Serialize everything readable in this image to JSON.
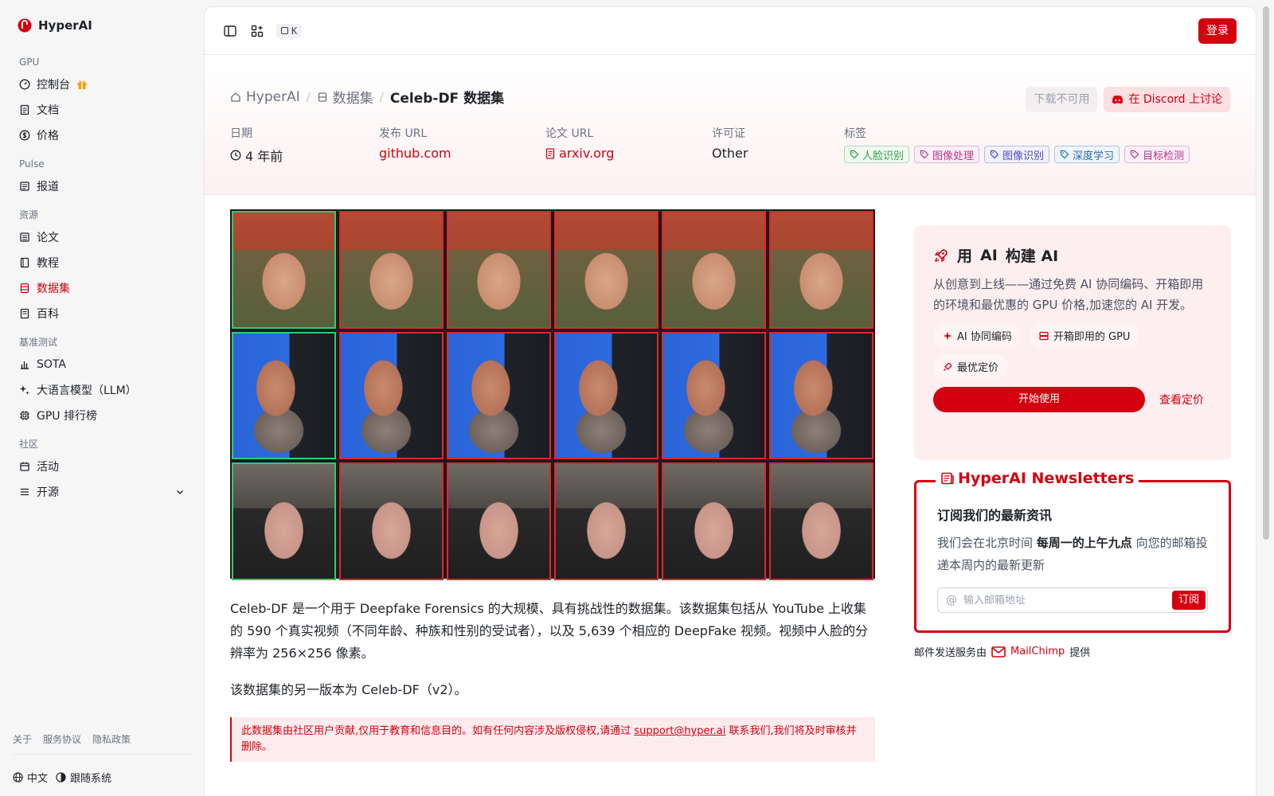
{
  "brand": {
    "name": "HyperAI"
  },
  "sidebar": {
    "groups": [
      {
        "title": "GPU",
        "items": [
          {
            "label": "控制台",
            "icon": "dashboard-icon",
            "gift": true
          },
          {
            "label": "文档",
            "icon": "doc-icon"
          },
          {
            "label": "价格",
            "icon": "price-icon"
          }
        ]
      },
      {
        "title": "Pulse",
        "items": [
          {
            "label": "报道",
            "icon": "news-icon"
          }
        ]
      },
      {
        "title": "资源",
        "items": [
          {
            "label": "论文",
            "icon": "paper-icon"
          },
          {
            "label": "教程",
            "icon": "tutorial-icon"
          },
          {
            "label": "数据集",
            "icon": "database-icon",
            "active": true
          },
          {
            "label": "百科",
            "icon": "wiki-icon"
          }
        ]
      },
      {
        "title": "基准测试",
        "items": [
          {
            "label": "SOTA",
            "icon": "chart-icon"
          },
          {
            "label": "大语言模型（LLM）",
            "icon": "sparkle-icon"
          },
          {
            "label": "GPU 排行榜",
            "icon": "cpu-icon"
          }
        ]
      },
      {
        "title": "社区",
        "items": [
          {
            "label": "活动",
            "icon": "calendar-icon"
          },
          {
            "label": "开源",
            "icon": "menu-icon",
            "expand": true
          }
        ]
      }
    ],
    "footer_links": [
      "关于",
      "服务协议",
      "隐私政策"
    ],
    "language": "中文",
    "theme": "跟随系统"
  },
  "topbar": {
    "shortcut": "K",
    "login": "登录"
  },
  "breadcrumb": {
    "home": "HyperAI",
    "section": "数据集",
    "current": "Celeb-DF 数据集"
  },
  "hero_actions": {
    "download": "下载不可用",
    "discord": "在 Discord 上讨论"
  },
  "meta": {
    "date_label": "日期",
    "date": "4 年前",
    "release_label": "发布 URL",
    "release": "github.com",
    "paper_label": "论文 URL",
    "paper": "arxiv.org",
    "license_label": "许可证",
    "license": "Other",
    "tags_label": "标签",
    "tags": [
      {
        "label": "人脸识别",
        "color": "#2f9e44",
        "bg": "#f0faf2"
      },
      {
        "label": "图像处理",
        "color": "#b3378a",
        "bg": "#fcf0f8"
      },
      {
        "label": "图像识别",
        "color": "#4c4bb8",
        "bg": "#f1f1fd"
      },
      {
        "label": "深度学习",
        "color": "#2b6cb0",
        "bg": "#eef5fd"
      },
      {
        "label": "目标检测",
        "color": "#b3378a",
        "bg": "#fcf0f8"
      }
    ]
  },
  "content": {
    "description": "Celeb-DF 是一个用于 Deepfake Forensics 的大规模、具有挑战性的数据集。该数据集包括从 YouTube 上收集的 590 个真实视频（不同年龄、种族和性别的受试者），以及 5,639 个相应的 DeepFake 视频。视频中人脸的分辨率为 256×256 像素。",
    "version_note": "该数据集的另一版本为 Celeb-DF（v2）。",
    "notice_prefix": "此数据集由社区用户贡献,仅用于教育和信息目的。如有任何内容涉及版权侵权,请通过 ",
    "notice_email": "support@hyper.ai",
    "notice_suffix": " 联系我们,我们将及时审核并删除。"
  },
  "promo": {
    "title_prefix": "用",
    "title_ai": "AI",
    "title_suffix": "构建 AI",
    "text": "从创意到上线——通过免费 AI 协同编码、开箱即用的环境和最优惠的 GPU 价格,加速您的 AI 开发。",
    "chips": [
      "AI 协同编码",
      "开箱即用的 GPU",
      "最优定价"
    ],
    "start": "开始使用",
    "pricing": "查看定价"
  },
  "newsletter": {
    "legend": "HyperAI Newsletters",
    "title": "订阅我们的最新资讯",
    "text_prefix": "我们会在北京时间 ",
    "text_bold": "每周一的上午九点",
    "text_suffix": " 向您的邮箱投递本周内的最新更新",
    "placeholder": "输入邮箱地址",
    "subscribe": "订阅",
    "credit_prefix": "邮件发送服务由",
    "credit_brand": "MailChimp",
    "credit_suffix": "提供"
  },
  "colors": {
    "brand": "#d4000f",
    "real_border": "#2ecc71",
    "fake_border": "#e0262e"
  }
}
